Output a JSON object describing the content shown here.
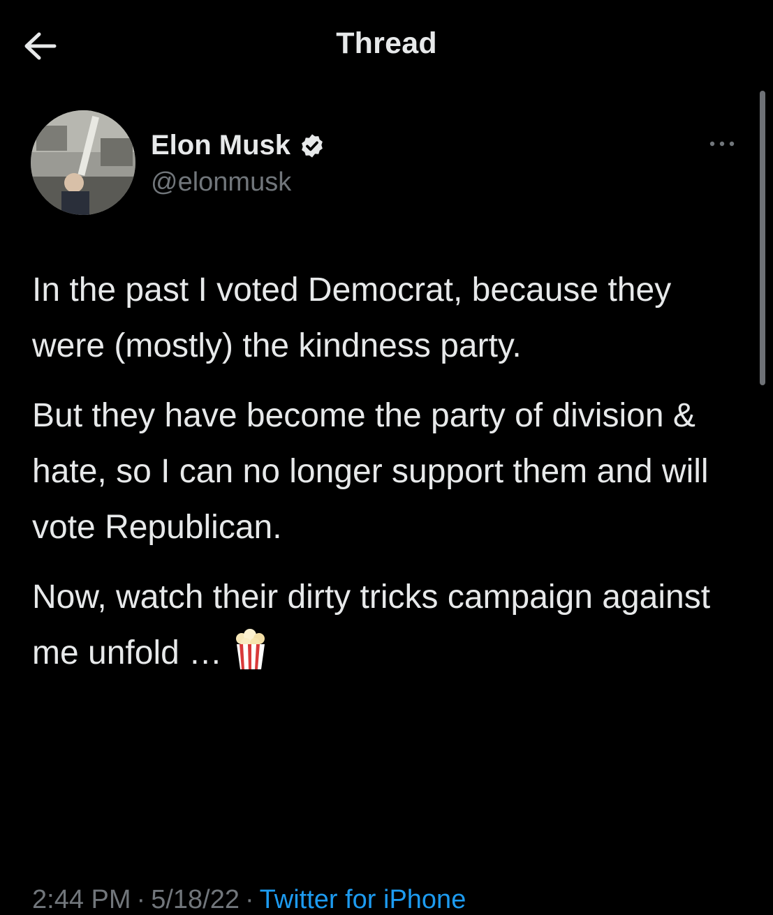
{
  "header": {
    "title": "Thread"
  },
  "tweet": {
    "author_name": "Elon Musk",
    "author_handle": "@elonmusk",
    "paragraphs": [
      "In the past I voted Democrat, because they were (mostly) the kindness party.",
      "But they have become the party of division & hate, so I can no longer support them and will vote Republican.",
      "Now, watch their dirty tricks campaign against me unfold …"
    ],
    "time": "2:44 PM",
    "separator": "·",
    "date": "5/18/22",
    "source": "Twitter for iPhone"
  },
  "icons": {
    "back": "left-arrow-icon",
    "verified": "verified-badge-icon",
    "more": "more-dots-icon",
    "popcorn": "popcorn-icon"
  },
  "colors": {
    "background": "#000000",
    "text_primary": "#e7e9ea",
    "text_secondary": "#71767b",
    "link": "#1d9bf0"
  }
}
